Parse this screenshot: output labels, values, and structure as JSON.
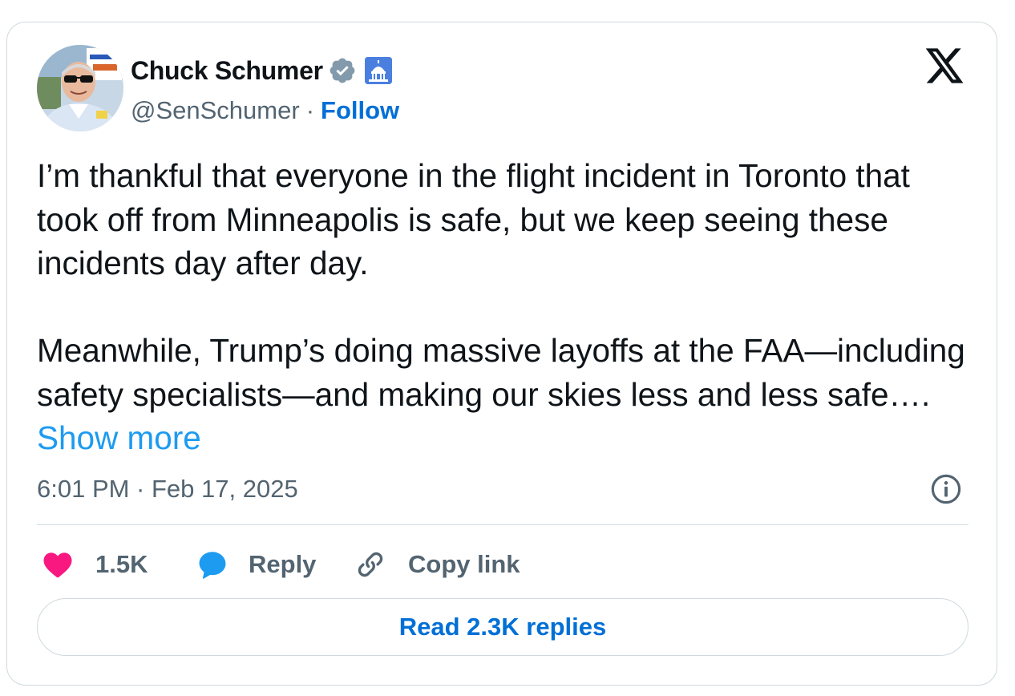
{
  "author": {
    "name": "Chuck Schumer",
    "handle": "@SenSchumer",
    "separator": "·",
    "follow_label": "Follow",
    "avatar_icon": "profile-photo",
    "verified_icon": "verified-badge-icon",
    "affiliation_icon": "capitol-dome-icon"
  },
  "platform": {
    "logo_icon": "x-logo-icon"
  },
  "tweet": {
    "text": "I’m thankful that everyone in the flight incident in Toronto that took off from Minneapolis is safe, but we keep seeing these incidents day after day.\n\nMeanwhile, Trump’s doing massive layoffs at the FAA—including safety specialists—and making our skies less and less safe…. ",
    "show_more_label": "Show more",
    "timestamp": "6:01 PM · Feb 17, 2025"
  },
  "actions": {
    "like_count": "1.5K",
    "reply_label": "Reply",
    "copy_link_label": "Copy link"
  },
  "footer": {
    "read_replies_label": "Read 2.3K replies"
  },
  "colors": {
    "text": "#0f1419",
    "secondary": "#536471",
    "link": "#006fd6",
    "show_more": "#1d9bf0",
    "like": "#f91880",
    "reply": "#1d9bf0",
    "border": "#cfd9de"
  }
}
